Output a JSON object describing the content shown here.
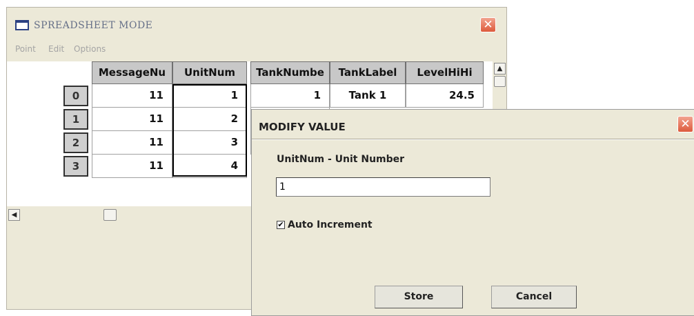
{
  "window": {
    "title": "SPREADSHEET MODE",
    "close_glyph": "✕",
    "menu": [
      "Point",
      "Edit",
      "Options"
    ]
  },
  "sheet": {
    "columns": [
      "MessageNu",
      "UnitNum",
      "TankNumbe",
      "TankLabel",
      "LevelHiHi"
    ],
    "row_headers": [
      "0",
      "1",
      "2",
      "3"
    ],
    "rows": [
      [
        "11",
        "1",
        "1",
        "Tank 1",
        "24.5"
      ],
      [
        "11",
        "2",
        "",
        "",
        ""
      ],
      [
        "11",
        "3",
        "",
        "",
        ""
      ],
      [
        "11",
        "4",
        "",
        "",
        ""
      ]
    ],
    "scroll_up_glyph": "▲",
    "scroll_left_glyph": "◀"
  },
  "dialog": {
    "title": "MODIFY VALUE",
    "close_glyph": "✕",
    "field_label": "UnitNum - Unit Number",
    "value": "1",
    "auto_increment_label": "Auto Increment",
    "auto_increment_checked": true,
    "check_glyph": "✔",
    "store_label": "Store",
    "cancel_label": "Cancel"
  },
  "colors": {
    "close_button": "#dd5a3c",
    "window_bg": "#ece9d8",
    "header_bg": "#c8c8c8"
  }
}
